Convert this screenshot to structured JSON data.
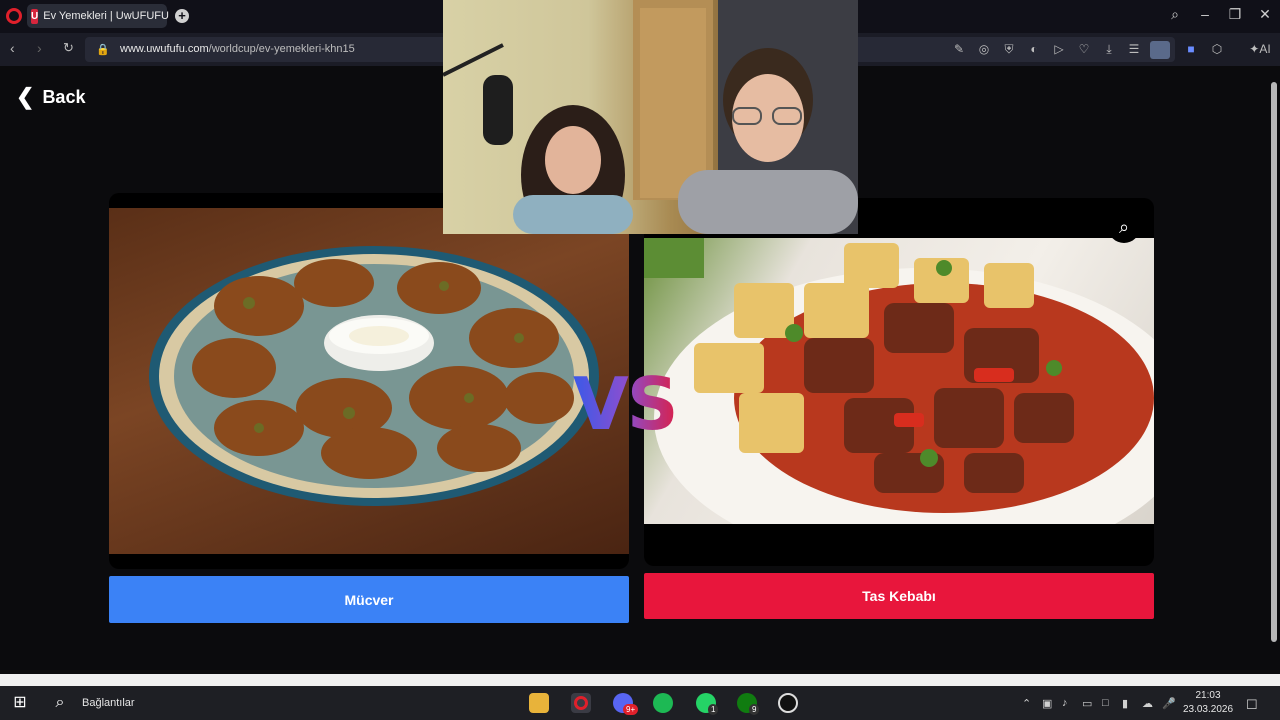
{
  "browser": {
    "tab_title": "Ev Yemekleri | UwUFUFU",
    "tab_favicon": "U",
    "url_host": "www.uwufufu.com",
    "url_path": "/worldcup/ev-yemekleri-khn15",
    "ai_label": "AI"
  },
  "page": {
    "back_label": "Back",
    "vs_label": "VS",
    "left_choice": {
      "label": "Mücver",
      "color": "#3b82f6"
    },
    "right_choice": {
      "label": "Tas Kebabı",
      "color": "#e8163c"
    }
  },
  "taskbar": {
    "search_label": "Bağlantılar",
    "time": "21:03",
    "date": "23.03.2026",
    "badges": {
      "discord": "9+",
      "whatsapp": "1",
      "xbox": "9"
    }
  }
}
